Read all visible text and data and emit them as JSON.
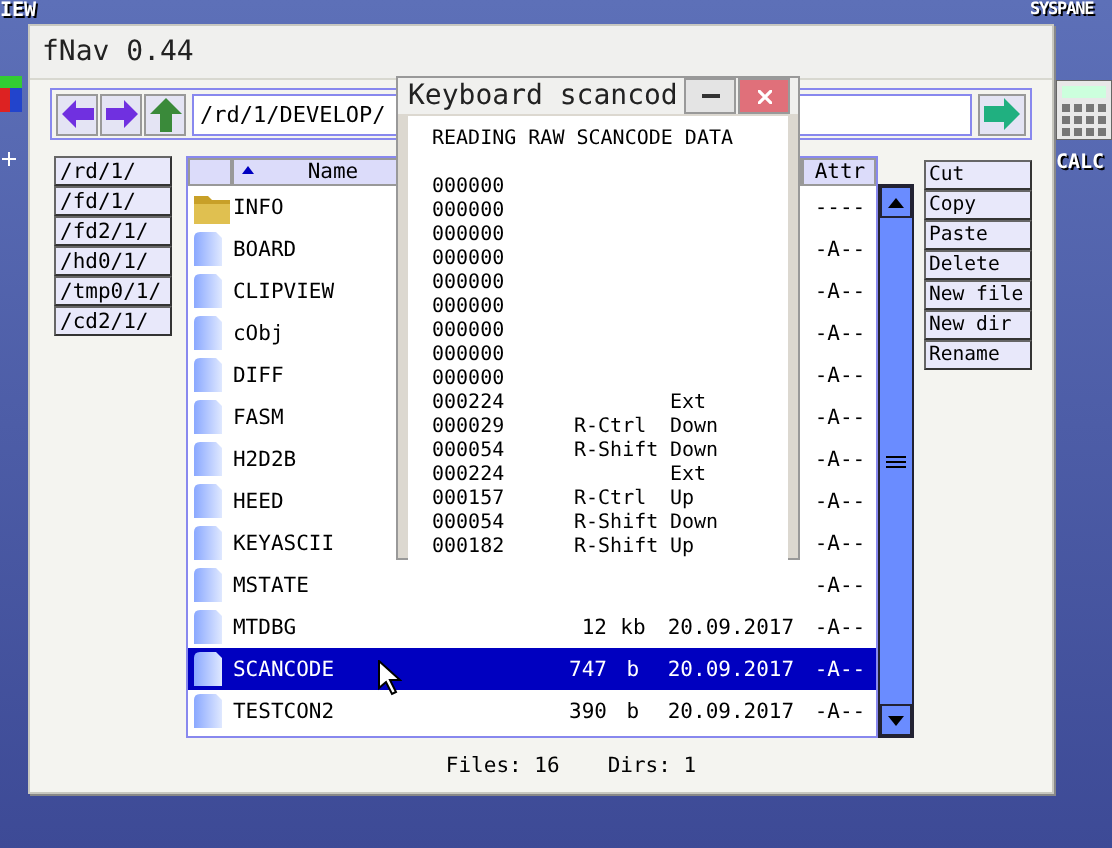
{
  "desktop": {
    "left_label": "IEW",
    "right_label": "SYSPANE",
    "calc_label": "CALC"
  },
  "window": {
    "title": "fNav 0.44"
  },
  "path": {
    "value": "/rd/1/DEVELOP/"
  },
  "drives": [
    "/rd/1/",
    "/fd/1/",
    "/fd2/1/",
    "/hd0/1/",
    "/tmp0/1/",
    "/cd2/1/"
  ],
  "columns": {
    "name": "Name",
    "attr": "Attr"
  },
  "files": [
    {
      "kind": "folder",
      "name": "INFO",
      "attr": "----",
      "selected": false
    },
    {
      "kind": "file",
      "name": "BOARD",
      "attr": "-A--",
      "selected": false
    },
    {
      "kind": "file",
      "name": "CLIPVIEW",
      "attr": "-A--",
      "selected": false
    },
    {
      "kind": "file",
      "name": "cObj",
      "attr": "-A--",
      "selected": false
    },
    {
      "kind": "file",
      "name": "DIFF",
      "attr": "-A--",
      "selected": false
    },
    {
      "kind": "file",
      "name": "FASM",
      "attr": "-A--",
      "selected": false
    },
    {
      "kind": "file",
      "name": "H2D2B",
      "attr": "-A--",
      "selected": false
    },
    {
      "kind": "file",
      "name": "HEED",
      "attr": "-A--",
      "selected": false
    },
    {
      "kind": "file",
      "name": "KEYASCII",
      "attr": "-A--",
      "selected": false
    },
    {
      "kind": "file",
      "name": "MSTATE",
      "attr": "-A--",
      "selected": false
    },
    {
      "kind": "file",
      "name": "MTDBG",
      "size": "12",
      "unit": "kb",
      "date": "20.09.2017",
      "attr": "-A--",
      "selected": false
    },
    {
      "kind": "file",
      "name": "SCANCODE",
      "size": "747",
      "unit": "b",
      "date": "20.09.2017",
      "attr": "-A--",
      "selected": true
    },
    {
      "kind": "file",
      "name": "TESTCON2",
      "size": "390",
      "unit": "b",
      "date": "20.09.2017",
      "attr": "-A--",
      "selected": false
    }
  ],
  "actions": [
    "Cut",
    "Copy",
    "Paste",
    "Delete",
    "New file",
    "New dir",
    "Rename"
  ],
  "status": {
    "files": "Files: 16",
    "dirs": "Dirs: 1"
  },
  "dialog": {
    "title": "Keyboard scancod",
    "heading": "READING RAW SCANCODE DATA",
    "lines": [
      {
        "code": "000000"
      },
      {
        "code": "000000"
      },
      {
        "code": "000000"
      },
      {
        "code": "000000"
      },
      {
        "code": "000000"
      },
      {
        "code": "000000"
      },
      {
        "code": "000000"
      },
      {
        "code": "000000"
      },
      {
        "code": "000000"
      },
      {
        "code": "000224",
        "event": "Ext"
      },
      {
        "code": "000029",
        "key": "R-Ctrl",
        "event": "Down"
      },
      {
        "code": "000054",
        "key": "R-Shift",
        "event": "Down"
      },
      {
        "code": "000224",
        "event": "Ext"
      },
      {
        "code": "000157",
        "key": "R-Ctrl",
        "event": "Up"
      },
      {
        "code": "000054",
        "key": "R-Shift",
        "event": "Down"
      },
      {
        "code": "000182",
        "key": "R-Shift",
        "event": "Up"
      }
    ]
  }
}
